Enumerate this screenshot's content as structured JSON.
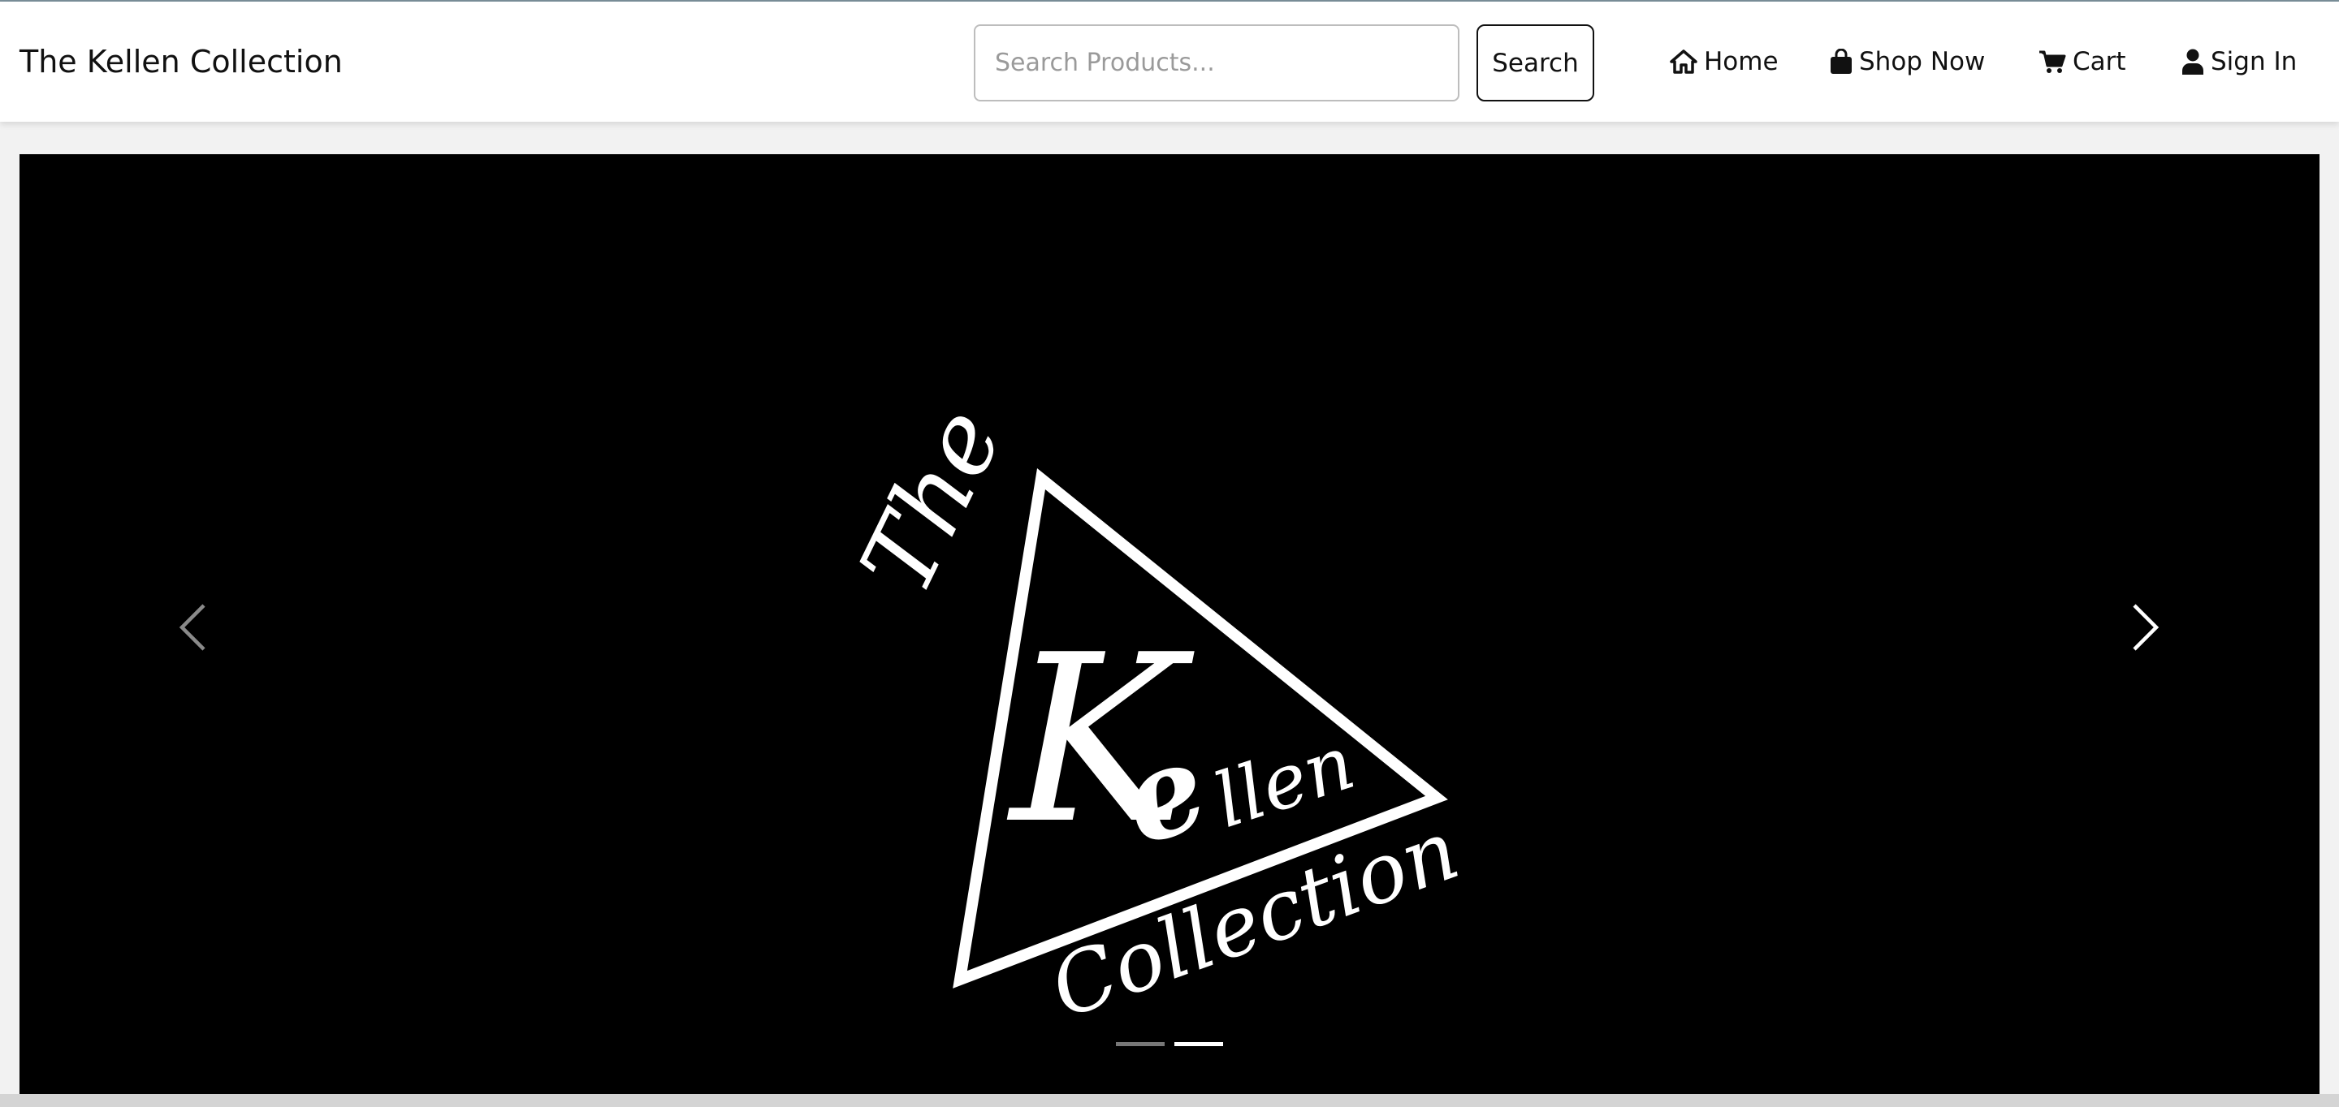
{
  "brand": {
    "title": "The Kellen Collection"
  },
  "search": {
    "placeholder": "Search Products...",
    "value": "",
    "button_label": "Search"
  },
  "nav": {
    "items": [
      {
        "label": "Home",
        "icon": "home-icon"
      },
      {
        "label": "Shop Now",
        "icon": "shopping-bag-icon"
      },
      {
        "label": "Cart",
        "icon": "cart-icon"
      },
      {
        "label": "Sign In",
        "icon": "user-icon"
      }
    ]
  },
  "hero": {
    "logo": {
      "top_word": "The",
      "main_initial": "K",
      "second_initial": "e",
      "rest": "llen",
      "bottom_word": "Collection"
    },
    "slides_total": 2,
    "active_slide": 2,
    "prev_icon": "chevron-left-icon",
    "next_icon": "chevron-right-icon"
  },
  "colors": {
    "navbar_bg": "#ffffff",
    "hero_bg": "#000000",
    "text": "#111111",
    "indicator_active": "#ffffff",
    "indicator_inactive": "#777777"
  }
}
